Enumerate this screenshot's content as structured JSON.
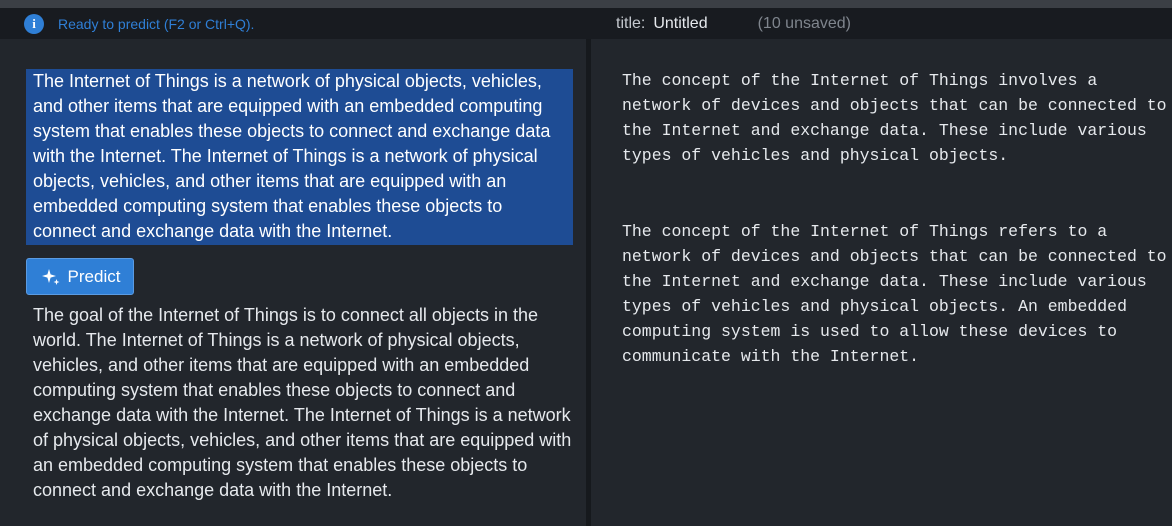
{
  "status": {
    "icon": "info-icon",
    "icon_glyph": "i",
    "text": "Ready to predict (F2 or Ctrl+Q)."
  },
  "document": {
    "title_label": "title:",
    "title": "Untitled",
    "unsaved": "(10 unsaved)"
  },
  "editor": {
    "input_text": "The Internet of Things is a network of physical objects, vehicles, and other items that are equipped with an embedded computing system that enables these objects to connect and exchange data with the Internet.  The Internet of Things is a network of physical objects, vehicles, and other items that are equipped with an embedded computing system that enables these objects to connect and exchange data with the Internet.",
    "predict_label": "Predict",
    "predict_icon": "sparkle-icon",
    "output_text": "The goal of the Internet of Things is to connect all objects in the world.  The Internet of Things is a network of physical objects, vehicles, and other items that are equipped with an embedded computing system that enables these objects to connect and exchange data with the Internet.  The Internet of Things is a network of physical objects, vehicles, and other items that are equipped with an embedded computing system that enables these objects to connect and exchange data with the Internet."
  },
  "predictions": [
    "The concept of the Internet of Things involves a network of devices and objects that can be connected to the Internet and exchange data. These include various types of vehicles and physical objects.",
    "The concept of the Internet of Things refers to a network of devices and objects that can be connected to the Internet and exchange data. These include various types of vehicles and physical objects. An embedded computing system is used to allow these devices to communicate with the Internet."
  ],
  "colors": {
    "accent": "#2f7fd6",
    "selection": "#1e4c94",
    "background": "#22262c",
    "statusbar": "#181b20"
  }
}
